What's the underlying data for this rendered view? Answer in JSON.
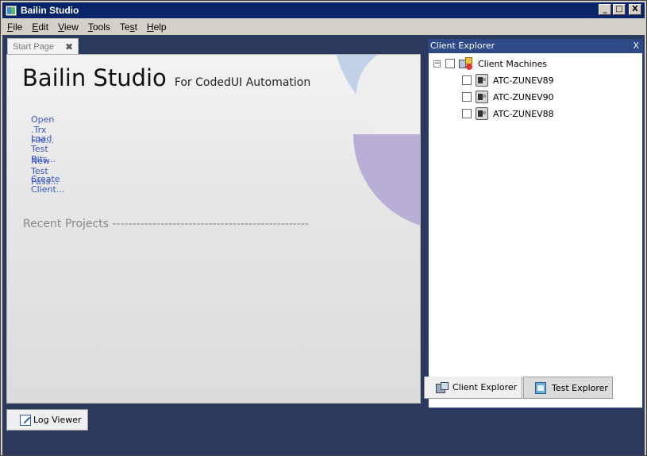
{
  "window": {
    "title": "Bailin Studio",
    "controls": {
      "minimize": "_",
      "maximize": "□",
      "close": "X"
    }
  },
  "menu": [
    {
      "accel": "F",
      "rest": "ile"
    },
    {
      "accel": "E",
      "rest": "dit"
    },
    {
      "accel": "V",
      "rest": "iew"
    },
    {
      "accel": "T",
      "rest": "ools"
    },
    {
      "pre": "Te",
      "accel": "s",
      "rest": "t"
    },
    {
      "accel": "H",
      "rest": "elp"
    }
  ],
  "document": {
    "tab_label": "Start Page",
    "tab_close": "✖",
    "heading": "Bailin Studio",
    "subheading": "For CodedUI Automation",
    "links": [
      "Open .Trx File...",
      "Load Test Bits...",
      "New Test Pass...",
      "Create Client..."
    ],
    "recent_projects": "Recent Projects -------------------------------------------------"
  },
  "log_viewer": {
    "label": "Log Viewer"
  },
  "client_explorer": {
    "header": "Client Explorer",
    "close": "X",
    "root": {
      "label": "Client Machines",
      "expander": "−",
      "checked": false
    },
    "machines": [
      {
        "label": "ATC-ZUNEV89",
        "checked": false
      },
      {
        "label": "ATC-ZUNEV90",
        "checked": false
      },
      {
        "label": "ATC-ZUNEV88",
        "checked": false
      }
    ]
  },
  "bottom_tabs": {
    "client_explorer": "Client Explorer",
    "test_explorer": "Test Explorer"
  },
  "colors": {
    "title_bar": "#0a246a",
    "workspace": "#2b3a5c",
    "panel_header": "#2e4a86",
    "link": "#3b57c4"
  }
}
